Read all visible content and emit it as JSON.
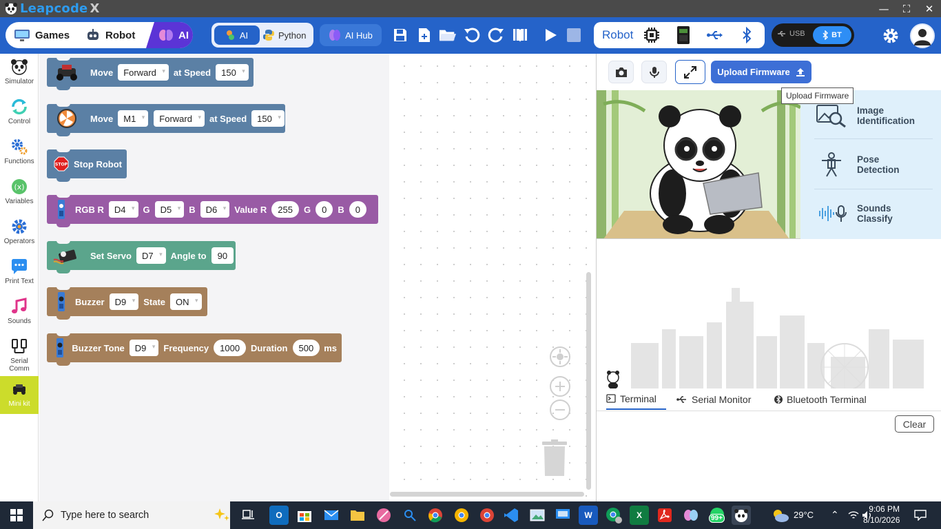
{
  "app": {
    "title": "Leapcode",
    "title_suffix": "X",
    "window_controls": {
      "minimize": "—",
      "maximize": "⛶",
      "close": "✕"
    }
  },
  "toolbar": {
    "modes": [
      {
        "label": "Games"
      },
      {
        "label": "Robot"
      },
      {
        "label": "AI"
      }
    ],
    "languages": {
      "ai_label": "AI",
      "python_label": "Python"
    },
    "ai_hub_label": "AI Hub",
    "robot_label": "Robot",
    "connection": {
      "usb_label": "USB",
      "bt_label": "BT"
    }
  },
  "sidebar": {
    "categories": [
      {
        "label": "Simulator",
        "icon": "panda-icon"
      },
      {
        "label": "Control",
        "icon": "refresh-icon"
      },
      {
        "label": "Functions",
        "icon": "gears-icon"
      },
      {
        "label": "Variables",
        "icon": "variable-icon"
      },
      {
        "label": "Operators",
        "icon": "gear-icon"
      },
      {
        "label": "Print Text",
        "icon": "chat-icon"
      },
      {
        "label": "Sounds",
        "icon": "music-note-icon"
      },
      {
        "label": "Serial\nComm",
        "icon": "cable-icon"
      },
      {
        "label": "Mini kit",
        "icon": "car-icon",
        "active": true
      }
    ]
  },
  "blocks": {
    "move": {
      "label": "Move",
      "direction": "Forward",
      "speed_label": "at Speed",
      "speed": "150"
    },
    "move_motor": {
      "label": "Move",
      "motor": "M1",
      "direction": "Forward",
      "speed_label": "at Speed",
      "speed": "150"
    },
    "stop": {
      "label": "Stop Robot",
      "icon_text": "STOP"
    },
    "rgb": {
      "label_r": "RGB R",
      "pin_r": "D4",
      "label_g": "G",
      "pin_g": "D5",
      "label_b": "B",
      "pin_b": "D6",
      "value_label": "Value R",
      "value_r": "255",
      "value_g_label": "G",
      "value_g": "0",
      "value_b_label": "B",
      "value_b": "0"
    },
    "servo": {
      "label": "Set Servo",
      "pin": "D7",
      "angle_label": "Angle to",
      "angle": "90"
    },
    "buzzer": {
      "label": "Buzzer",
      "pin": "D9",
      "state_label": "State",
      "state": "ON"
    },
    "buzzer_tone": {
      "label": "Buzzer Tone",
      "pin": "D9",
      "freq_label": "Frequency",
      "freq": "1000",
      "dur_label": "Duration",
      "dur": "500",
      "unit": "ms"
    }
  },
  "right_panel": {
    "upload_label": "Upload Firmware",
    "tooltip": "Upload Firmware",
    "ai_menu": [
      {
        "label": "Image\nIdentification",
        "icon": "image-search-icon"
      },
      {
        "label": "Pose\nDetection",
        "icon": "pose-icon"
      },
      {
        "label": "Sounds\nClassify",
        "icon": "sound-wave-mic-icon"
      }
    ],
    "tabs": [
      {
        "label": "Terminal",
        "active": true
      },
      {
        "label": "Serial Monitor"
      },
      {
        "label": "Bluetooth Terminal"
      }
    ],
    "clear_label": "Clear"
  },
  "taskbar": {
    "search_placeholder": "Type here to search",
    "weather": "29°C",
    "time": "9:06 PM",
    "date": "8/10/2026",
    "notification_badge": "99+"
  },
  "colors": {
    "toolbar": "#2563c9",
    "ai_mode": "#5b34d6",
    "block_blue": "#5b80a5",
    "block_purple": "#995ba5",
    "block_green": "#5ba58c",
    "block_brown": "#a5805b",
    "active_category": "#ccdc2b"
  }
}
